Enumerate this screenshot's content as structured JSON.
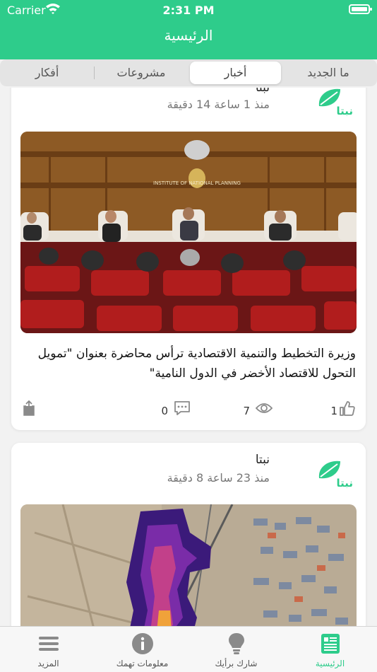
{
  "status_bar": {
    "carrier": "Carrier",
    "time": "2:31 PM"
  },
  "header": {
    "title": "الرئيسية"
  },
  "tabs": [
    {
      "label": "ما الجديد",
      "active": false
    },
    {
      "label": "أخبار",
      "active": true
    },
    {
      "label": "مشروعات",
      "active": false
    },
    {
      "label": "أفكار",
      "active": false
    }
  ],
  "posts": [
    {
      "author": "نبتا",
      "time": "منذ 1 ساعة 14 دقيقة",
      "logo_text": "نبتا",
      "title": "وزيرة التخطيط والتنمية الاقتصادية ترأس محاضرة بعنوان \"تمويل التحول للاقتصاد الأخضر في الدول النامية\"",
      "image_sign": "INSTITUTE OF NATIONAL PLANNING",
      "likes": "1",
      "views": "7",
      "comments": "0"
    },
    {
      "author": "نبتا",
      "time": "منذ 23 ساعة 8 دقيقة",
      "logo_text": "نبتا"
    }
  ],
  "tabbar": [
    {
      "label": "الرئيسية",
      "icon": "news-icon",
      "active": true
    },
    {
      "label": "شارك برأيك",
      "icon": "lightbulb-icon",
      "active": false
    },
    {
      "label": "معلومات تهمك",
      "icon": "info-icon",
      "active": false
    },
    {
      "label": "المزيد",
      "icon": "menu-icon",
      "active": false
    }
  ],
  "colors": {
    "brand": "#2ecc8b",
    "icon_gray": "#8a8a8a"
  }
}
